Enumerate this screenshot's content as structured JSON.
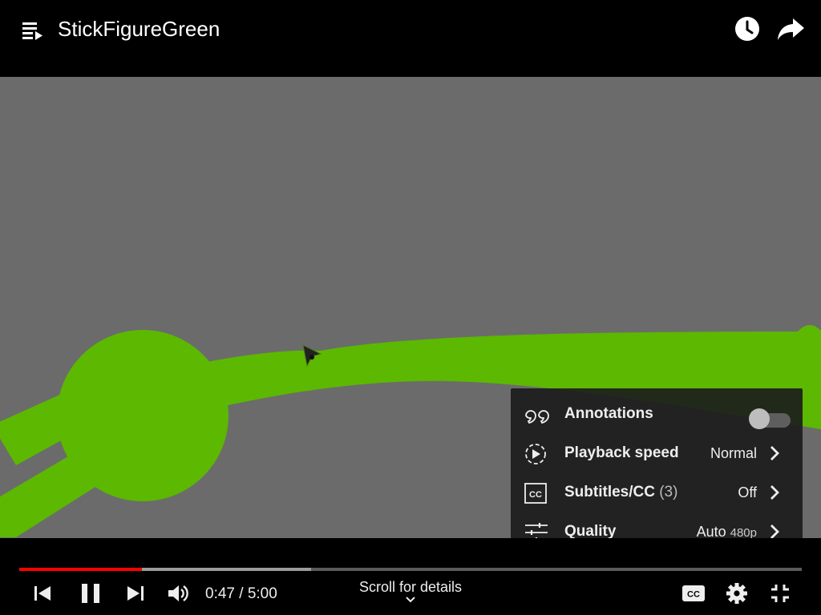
{
  "header": {
    "title": "StickFigureGreen",
    "playlist_icon": "playlist-queue-icon",
    "watch_later_icon": "clock-icon",
    "share_icon": "share-arrow-icon"
  },
  "settings_menu": {
    "items": [
      {
        "label": "Annotations",
        "icon": "quote-icon",
        "toggle_on": false
      },
      {
        "label": "Playback speed",
        "icon": "playback-speed-icon",
        "value": "Normal"
      },
      {
        "label": "Subtitles/CC",
        "count": "(3)",
        "icon": "cc-icon",
        "value": "Off"
      },
      {
        "label": "Quality",
        "icon": "sliders-icon",
        "value": "Auto",
        "value_sub": "480p"
      }
    ]
  },
  "player": {
    "current_time": "0:47",
    "duration": "5:00",
    "time_display": "0:47 / 5:00",
    "played_fraction": 0.157,
    "buffered_fraction": 0.373,
    "scroll_hint": "Scroll for details"
  },
  "colors": {
    "progress_played": "#ff0000",
    "video_background": "#6b6b6b",
    "figure_green": "#5cb800"
  }
}
